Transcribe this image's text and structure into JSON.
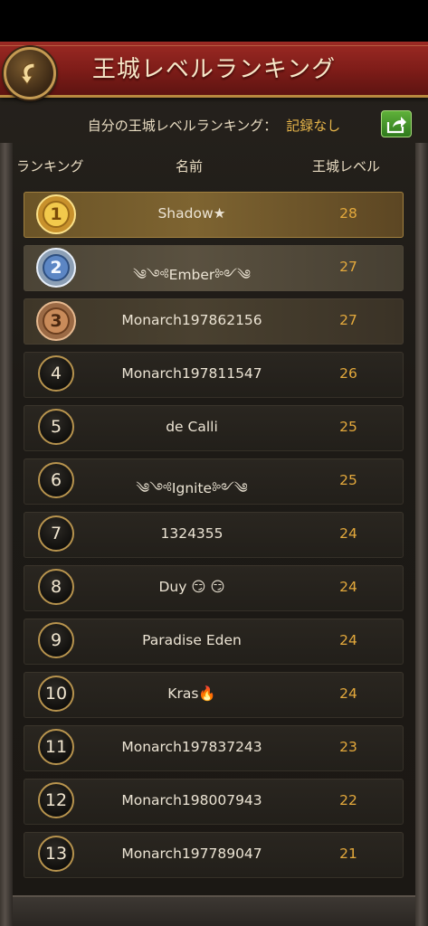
{
  "header": {
    "title": "王城レベルランキング"
  },
  "my_rank": {
    "label": "自分の王城レベルランキング：",
    "value": "記録なし"
  },
  "columns": {
    "rank": "ランキング",
    "name": "名前",
    "level": "王城レベル"
  },
  "rows": [
    {
      "rank": "1",
      "name": "Shadow★",
      "level": "28"
    },
    {
      "rank": "2",
      "name": "༄༺Ember༻༄",
      "level": "27"
    },
    {
      "rank": "3",
      "name": "Monarch197862156",
      "level": "27"
    },
    {
      "rank": "4",
      "name": "Monarch197811547",
      "level": "26"
    },
    {
      "rank": "5",
      "name": "de Calli",
      "level": "25"
    },
    {
      "rank": "6",
      "name": "༄༺Ignite༻༄",
      "level": "25"
    },
    {
      "rank": "7",
      "name": "1324355",
      "level": "24"
    },
    {
      "rank": "8",
      "name": "Duy 😏 😏",
      "level": "24"
    },
    {
      "rank": "9",
      "name": "Paradise Eden",
      "level": "24"
    },
    {
      "rank": "10",
      "name": "Kras🔥",
      "level": "24"
    },
    {
      "rank": "11",
      "name": "Monarch197837243",
      "level": "23"
    },
    {
      "rank": "12",
      "name": "Monarch198007943",
      "level": "22"
    },
    {
      "rank": "13",
      "name": "Monarch197789047",
      "level": "21"
    }
  ],
  "icons": {
    "back": "back-arrow-icon",
    "share": "share-icon",
    "medals": [
      "gold-medal-icon",
      "silver-medal-icon",
      "bronze-medal-icon"
    ]
  },
  "colors": {
    "title_bar": "#8a221d",
    "accent_gold": "#e4a93c",
    "text": "#ece4d4"
  }
}
